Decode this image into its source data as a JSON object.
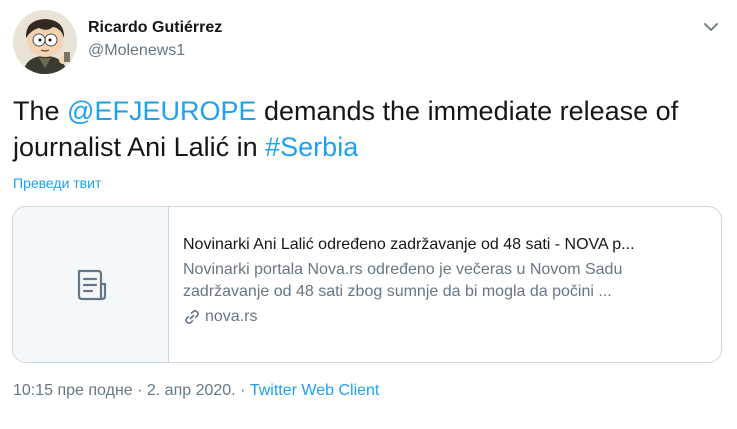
{
  "author": {
    "display_name": "Ricardo Gutiérrez",
    "handle": "@Molenews1"
  },
  "tweet": {
    "text_prefix": "The ",
    "mention": "@EFJEUROPE",
    "text_middle": " demands the immediate release of journalist Ani Lalić in ",
    "hashtag": "#Serbia",
    "translate_label": "Преведи твит"
  },
  "card": {
    "title": "Novinarki Ani Lalić određeno zadržavanje od 48 sati - NOVA p...",
    "description_line1": "Novinarki portala Nova.rs određeno je večeras u Novom Sadu",
    "description_line2": "zadržavanje od 48 sati zbog sumnje da bi mogla da počini ...",
    "domain": "nova.rs",
    "thumb_icon": "document-icon"
  },
  "meta": {
    "timestamp": "10:15 пре подне · 2. апр 2020. · ",
    "client": "Twitter Web Client"
  },
  "colors": {
    "link": "#1da1f2",
    "secondary_text": "#657786",
    "border": "#ccd6dd"
  }
}
